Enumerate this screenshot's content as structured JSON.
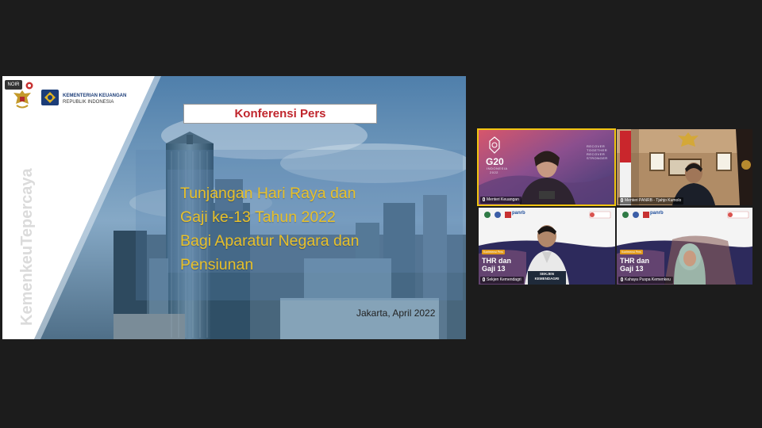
{
  "shared_slide": {
    "tag": "NOIR",
    "org_line1": "KEMENTERIAN KEUANGAN",
    "org_line2": "REPUBLIK INDONESIA",
    "side_text": "KemenkeuTepercaya",
    "press_label": "Konferensi Pers",
    "title_lines": [
      "Tunjangan Hari Raya dan",
      "Gaji ke-13 Tahun 2022",
      "Bagi Aparatur Negara dan",
      "Pensiunan"
    ],
    "date": "Jakarta, April 2022"
  },
  "gallery": {
    "tiles": [
      {
        "id": "menteri-keuangan",
        "name": "Menteri Keuangan",
        "g20_main": "G20",
        "g20_sub": "INDONESIA",
        "g20_year": "2022",
        "recover_1": "RECOVER",
        "recover_2": "TOGETHER",
        "recover_3": "RECOVER",
        "recover_4": "STRONGER",
        "active_speaker": true
      },
      {
        "id": "menteri-panrb",
        "name": "Menteri PANRB - Tjahjo Kumolo"
      },
      {
        "id": "sekjen-kemendagri",
        "name": "Sekjen Kemendagri",
        "thr_1": "THR dan",
        "thr_2": "Gaji 13",
        "badge": "Konferensi Pers",
        "brand": "panrb",
        "sign_1": "SEKJEN",
        "sign_2": "KEMENDAGRI"
      },
      {
        "id": "kepala-puspa",
        "name": "Kahaya Puspa Kemenkeu",
        "thr_1": "THR dan",
        "thr_2": "Gaji 13",
        "badge": "Konferensi Pers",
        "brand": "panrb"
      }
    ]
  },
  "colors": {
    "background": "#1c1c1c",
    "title_yellow": "#e8c02a",
    "press_red": "#c0262d",
    "active_border": "#f2c511",
    "kemenkeu_blue": "#1c3d78"
  }
}
